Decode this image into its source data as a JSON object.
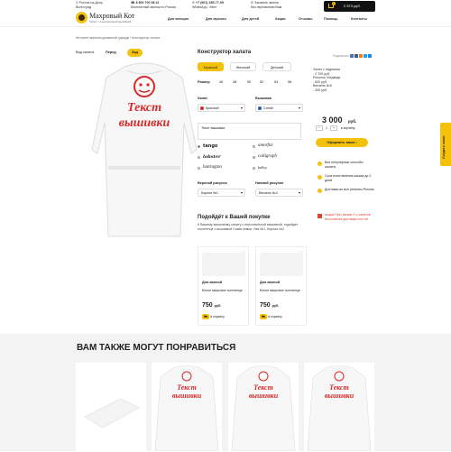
{
  "header": {
    "city": "Ростов-на-Дону",
    "city_sub": "Волгоград",
    "phone1": "8 800 700 98 41",
    "phone1_sub": "Бесплатный звонок по России",
    "phone2": "+7 (961) 285-77-99",
    "phone2_sub": "WhatsApp, Viber",
    "callback": "Заказать звонок",
    "callback_sub": "Мы перезвоним Вам",
    "cart_count": "1",
    "cart_sum": "2 573 руб.",
    "brand": "Махровый Кот",
    "brand_sub": "Халат с персональной вышивкой",
    "nav": [
      "Для женщин",
      "Для мужчин",
      "Для детей",
      "Акции",
      "Отзывы",
      "Помощь",
      "Контакты"
    ]
  },
  "breadcrumb": "Интернет-магазин домашней одежды / Конструктор халата",
  "view": {
    "label": "Вид халата",
    "front": "Перед",
    "back": "Зад"
  },
  "robe_text": [
    "Текст",
    "вышивки"
  ],
  "constructor": {
    "title": "Конструктор халата",
    "genders": [
      "Мужской",
      "Женский",
      "Детский"
    ],
    "size_label": "Размер",
    "sizes": [
      "46",
      "48",
      "50",
      "52",
      "54",
      "56"
    ],
    "robe_label": "Халат",
    "robe_value": "Красный",
    "embroidery_label": "Вышивка",
    "embroidery_value": "Синий",
    "text_value": "Текст вышивки",
    "fonts": [
      "tango",
      "amorfnz",
      "lobster",
      "calligraph",
      "barrington",
      "balloy"
    ],
    "top_label": "Верхний рисунок",
    "top_value": "Корона №1",
    "bottom_label": "Нижний рисунок",
    "bottom_value": "Вензель №4"
  },
  "side": {
    "share": "Поделиться",
    "lines": [
      "Халат с надписью",
      "- 2 700 руб.",
      "Рисунок: Медведь",
      "- 600 руб.",
      "Вензель №5",
      "- 300 руб."
    ],
    "price": "3 000",
    "currency": "руб.",
    "qty": "1",
    "qty_label": "в корзину",
    "order": "Оформить заказ",
    "features": [
      "Все популярные способы оплаты",
      "Срок изготовления заказа до 2 дней",
      "Доставка во все регионы России"
    ],
    "promo": "Акция! При заказе 2-х халатов бесплатная доставка почтой",
    "favorites": "Создать халат"
  },
  "suggest": {
    "title": "Подойдёт к Вашей покупке",
    "desc": "К Вашему махровому халату с персональной вышивкой, подойдёт полотенце с вышивкой Глава семьи, Лев №1, Корона №2",
    "cards": [
      {
        "title": "Для ванной",
        "desc": "Белое махровое полотенце",
        "price": "750",
        "rub": "руб.",
        "btn": "в корзину"
      },
      {
        "title": "Для ванной",
        "desc": "Белое махровое полотенце",
        "price": "750",
        "rub": "руб.",
        "btn": "в корзину"
      }
    ]
  },
  "also": {
    "title": "ВАМ ТАКЖЕ МОГУТ ПОНРАВИТЬСЯ",
    "robe_text": [
      "Текст",
      "вышивки"
    ]
  }
}
